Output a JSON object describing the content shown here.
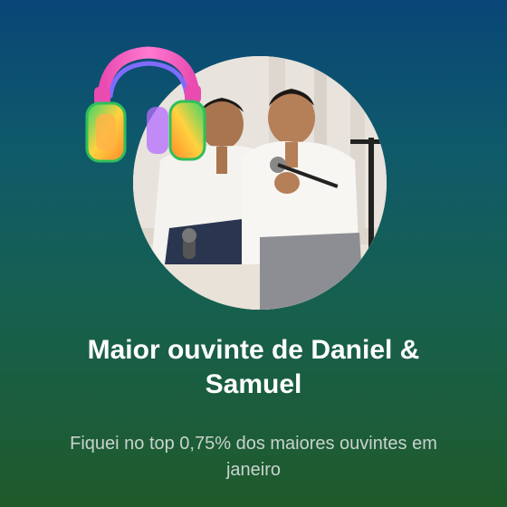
{
  "card": {
    "title": "Maior ouvinte de Daniel & Samuel",
    "subtitle": "Fiquei no top 0,75% dos maiores ouvintes em janeiro"
  },
  "icons": {
    "artist_photo": "artist-photo",
    "headphones": "headphones-icon"
  },
  "colors": {
    "background_top": "#0a4677",
    "background_bottom": "#1f5a2a",
    "title": "#ffffff",
    "subtitle": "#c9d3cf"
  }
}
